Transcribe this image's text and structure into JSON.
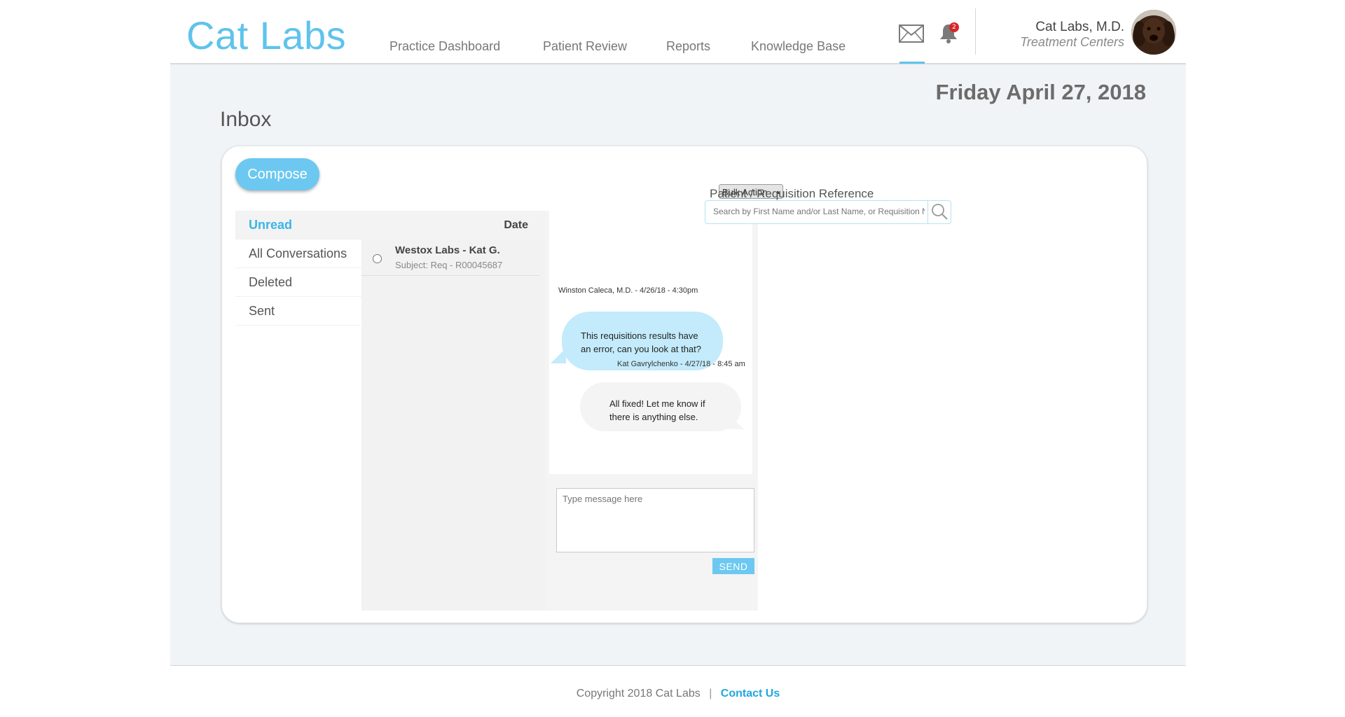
{
  "app": {
    "logo": "Cat Labs"
  },
  "nav": [
    {
      "label": "Practice Dashboard"
    },
    {
      "label": "Patient Review"
    },
    {
      "label": "Reports"
    },
    {
      "label": "Knowledge Base"
    }
  ],
  "header": {
    "notification_count": "2",
    "user_name": "Cat Labs, M.D.",
    "user_subtitle": "Treatment Centers",
    "icons": [
      "mail-icon",
      "bell-icon",
      "avatar"
    ]
  },
  "page": {
    "date": "Friday April 27, 2018",
    "title": "Inbox"
  },
  "toolbar": {
    "compose_label": "Compose",
    "bulk_action_label": "Bulk Action"
  },
  "folders": [
    {
      "label": "Unread",
      "active": true
    },
    {
      "label": "All Conversations"
    },
    {
      "label": "Deleted"
    },
    {
      "label": "Sent"
    }
  ],
  "message_list": {
    "date_header": "Date",
    "items": [
      {
        "from": "Westox Labs - Kat G.",
        "subject": "Subject: Req - R00045687"
      }
    ]
  },
  "conversation": {
    "messages": [
      {
        "meta": "Winston Caleca, M.D. - 4/26/18 - 4:30pm",
        "text": "This requisitions results have an error, can you look at that?"
      },
      {
        "meta": "Kat Gavrylchenko - 4/27/18 - 8:45 am",
        "text": "All fixed!  Let me know if there is anything else."
      }
    ],
    "input_placeholder": "Type message here",
    "send_label": "SEND"
  },
  "reference": {
    "label": "Patient / Requisition Reference",
    "placeholder": "Search by First Name and/or Last Name, or Requisition No."
  },
  "footer": {
    "copyright": "Copyright 2018 Cat Labs",
    "separator": "|",
    "contact": "Contact Us"
  },
  "colors": {
    "accent": "#5fc3ec",
    "incoming_bubble": "#c3ebfb",
    "badge": "#d6262a",
    "link": "#1ea7e0"
  }
}
